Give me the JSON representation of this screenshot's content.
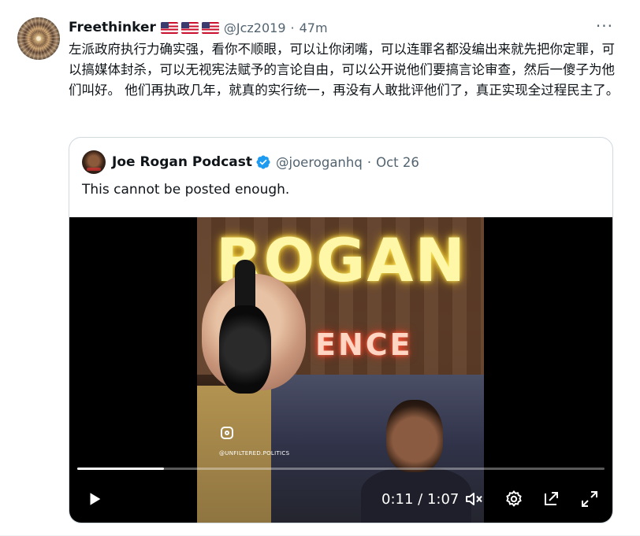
{
  "tweet": {
    "author_name": "Freethinker",
    "flags_count": 3,
    "handle": "@Jcz2019",
    "time": "47m",
    "separator": "·",
    "more_icon": "more-horizontal-icon",
    "text": "左派政府执行力确实强，看你不顺眼，可以让你闭嘴，可以连罪名都没编出来就先把你定罪，可以搞媒体封杀，可以无视宪法赋予的言论自由，可以公开说他们要搞言论审查，然后一傻子为他们叫好。 他们再执政几年，就真的实行统一，再没有人敢批评他们了，真正实现全过程民主了。"
  },
  "quoted": {
    "author_name": "Joe Rogan Podcast",
    "verified_icon": "verified-badge-icon",
    "handle": "@joeroganhq",
    "date": "Oct 26",
    "separator": "·",
    "text": "This cannot be posted enough.",
    "video": {
      "neon_sign": "ROGAN",
      "neon_sign_2": "ENCE",
      "watermark": "@UNFILTERED.POLITICS",
      "current_time": "0:11",
      "duration": "1:07",
      "time_separator": " / ",
      "progress": 0.164,
      "controls": [
        "play-icon",
        "volume-icon",
        "settings-icon",
        "pop-out-icon",
        "fullscreen-icon"
      ]
    }
  },
  "colors": {
    "text_primary": "#0f1419",
    "text_secondary": "#536471",
    "border": "#cfd9de",
    "verified": "#1d9bf0"
  }
}
